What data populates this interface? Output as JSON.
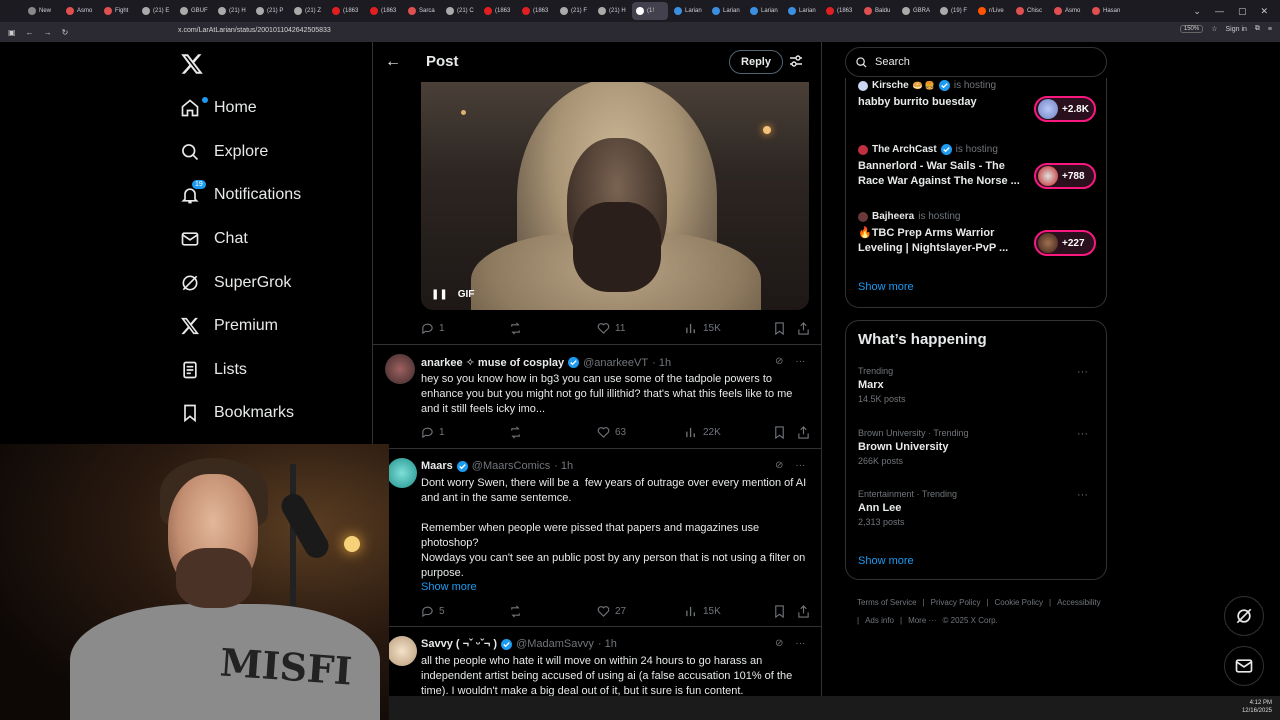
{
  "browser": {
    "tabs": [
      "New",
      "Asmo",
      "Fight",
      "(21) E",
      "GBUF",
      "(21) H",
      "(21) P",
      "(21) Z",
      "(1863",
      "(1863",
      "Sarca",
      "(21) C",
      "(1863",
      "(1863",
      "(21) F",
      "(21) H",
      "(1!",
      "Larian",
      "Larian",
      "Larian",
      "Larian",
      "(1863",
      "Baldu",
      "GBRA",
      "(19) F",
      "r/Live",
      "Chisc",
      "Asmo",
      "Hasan"
    ],
    "active_tab_index": 16,
    "url": "x.com/LarAtLarian/status/2001011042642505833",
    "zoom": "150%",
    "signin": "Sign in"
  },
  "nav": {
    "items": [
      {
        "label": "Home",
        "icon": "home-icon"
      },
      {
        "label": "Explore",
        "icon": "search-icon"
      },
      {
        "label": "Notifications",
        "icon": "bell-icon",
        "badge": "19"
      },
      {
        "label": "Chat",
        "icon": "mail-icon"
      },
      {
        "label": "SuperGrok",
        "icon": "grok-icon"
      },
      {
        "label": "Premium",
        "icon": "x-icon"
      },
      {
        "label": "Lists",
        "icon": "list-icon"
      },
      {
        "label": "Bookmarks",
        "icon": "bookmark-icon"
      }
    ]
  },
  "header": {
    "title": "Post",
    "reply_label": "Reply"
  },
  "main_post": {
    "gif_label": "GIF",
    "stats": {
      "replies": "1",
      "likes": "11",
      "views": "15K"
    }
  },
  "replies": [
    {
      "name": "anarkee ✧ muse of cosplay",
      "handle": "@anarkeeVT",
      "time": "· 1h",
      "text": "hey so you know how in bg3 you can use some of the tadpole powers to enhance you but you might not go full illithid? that's what this feels like to me and it still feels icky imo...",
      "replies": "1",
      "likes": "63",
      "views": "22K"
    },
    {
      "name": "Maars",
      "handle": "@MaarsComics",
      "time": "· 1h",
      "text": "Dont worry Swen, there will be a  few years of outrage over every mention of AI and ant in the same sentemce.\n\nRemember when people were pissed that papers and magazines use photoshop?\nNowdays you can't see an public post by any person that is not using a filter on purpose.",
      "show_more": "Show more",
      "replies": "5",
      "likes": "27",
      "views": "15K"
    },
    {
      "name": "Savvy ( ¬ˇ ᵕˇ¬ )",
      "handle": "@MadamSavvy",
      "time": "· 1h",
      "text": "all the people who hate it will move on within 24 hours to go harass an independent artist being accused of using ai (a false accusation 101% of the time). I wouldn't make a big deal out of it, but it sure is fun content."
    }
  ],
  "search": {
    "placeholder": "Search"
  },
  "spaces": {
    "items": [
      {
        "host": "Kirsche",
        "status": "is hosting",
        "title": "habby burrito buesday",
        "count": "+2.8K"
      },
      {
        "host": "The ArchCast",
        "status": "is hosting",
        "title": "Bannerlord - War Sails - The Race War Against The Norse ...",
        "count": "+788"
      },
      {
        "host": "Bajheera",
        "status": "is hosting",
        "title": "🔥TBC Prep Arms Warrior Leveling | Nightslayer-PvP ...",
        "count": "+227"
      }
    ],
    "show_more": "Show more"
  },
  "happening": {
    "title": "What’s happening",
    "trends": [
      {
        "context": "Trending",
        "title": "Marx",
        "count": "14.5K posts"
      },
      {
        "context": "Brown University · Trending",
        "title": "Brown University",
        "count": "266K posts"
      },
      {
        "context": "Entertainment · Trending",
        "title": "Ann Lee",
        "count": "2,313 posts"
      }
    ],
    "show_more": "Show more"
  },
  "footer": {
    "links": [
      "Terms of Service",
      "|",
      "Privacy Policy",
      "|",
      "Cookie Policy",
      "|",
      "Accessibility",
      "|",
      "Ads info",
      "|",
      "More ···",
      "© 2025 X Corp."
    ]
  },
  "webcam": {
    "shirt_text": "MISFI"
  },
  "tray": {
    "time": "4:12 PM",
    "date": "12/16/2025"
  },
  "colors": {
    "accent": "#1d9bf0",
    "live": "#f91880",
    "background": "#000000",
    "border": "#2f3336",
    "muted": "#71767b"
  }
}
